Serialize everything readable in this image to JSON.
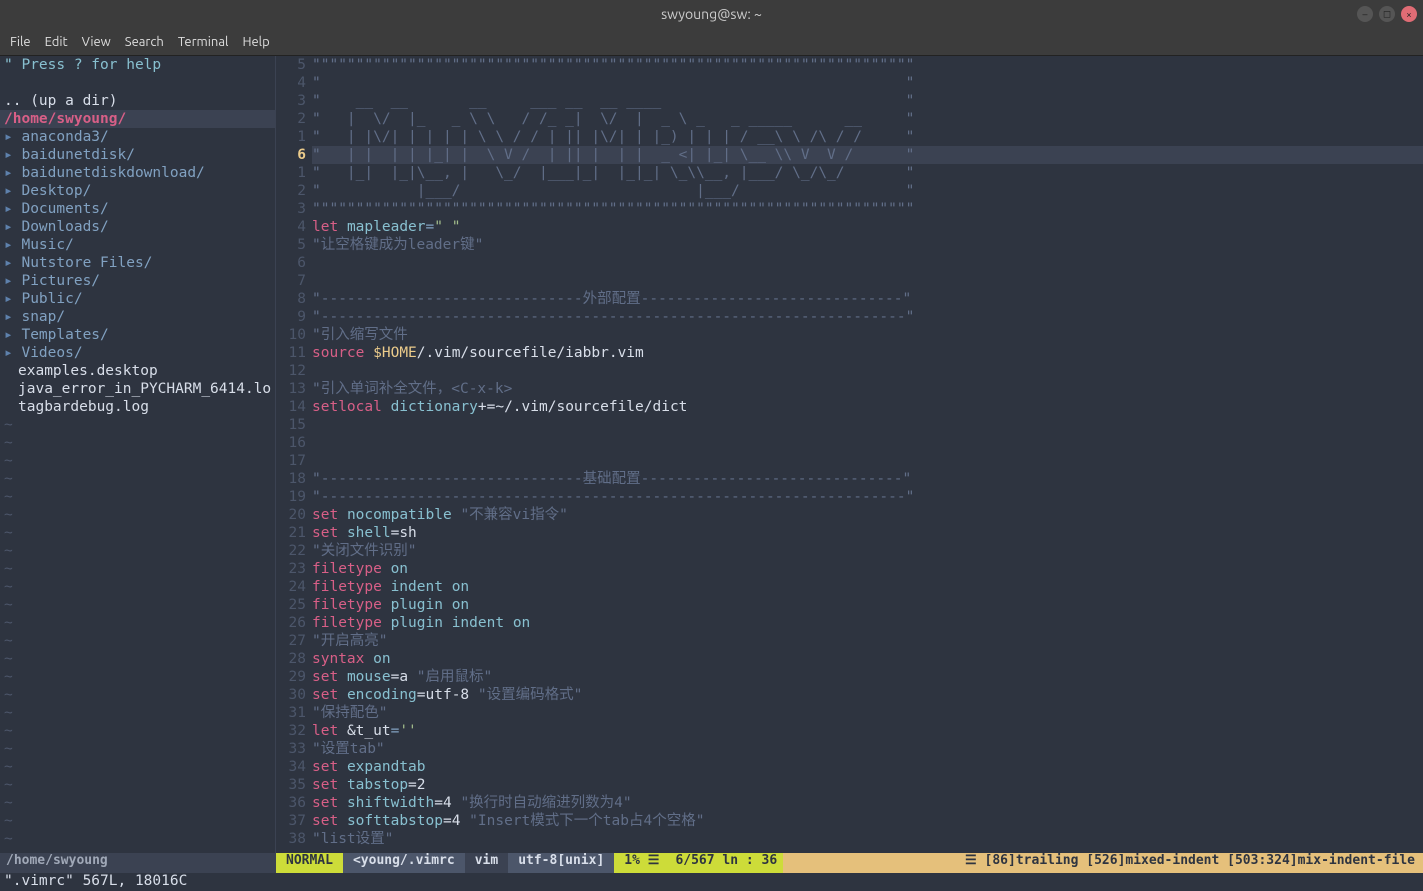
{
  "title": "swyoung@sw: ~",
  "menu": [
    "File",
    "Edit",
    "View",
    "Search",
    "Terminal",
    "Help"
  ],
  "sidebar": {
    "help": "\" Press ? for help",
    "updir": ".. (up a dir)",
    "cwd": "/home/swyoung/",
    "dirs": [
      "anaconda3/",
      "baidunetdisk/",
      "baidunetdiskdownload/",
      "Desktop/",
      "Documents/",
      "Downloads/",
      "Music/",
      "Nutstore Files/",
      "Pictures/",
      "Public/",
      "snap/",
      "Templates/",
      "Videos/"
    ],
    "files": [
      "examples.desktop",
      "java_error_in_PYCHARM_6414.lo",
      "tagbardebug.log"
    ]
  },
  "gutter": [
    "5",
    "4",
    "3",
    "2",
    "1",
    "6",
    "1",
    "2",
    "3",
    "4",
    "5",
    "6",
    "7",
    "8",
    "9",
    "10",
    "11",
    "12",
    "13",
    "14",
    "15",
    "16",
    "17",
    "18",
    "19",
    "20",
    "21",
    "22",
    "23",
    "24",
    "25",
    "26",
    "27",
    "28",
    "29",
    "30",
    "31",
    "32",
    "33",
    "34",
    "35",
    "36",
    "37",
    "38"
  ],
  "code": {
    "l0": "\"\"\"\"\"\"\"\"\"\"\"\"\"\"\"\"\"\"\"\"\"\"\"\"\"\"\"\"\"\"\"\"\"\"\"\"\"\"\"\"\"\"\"\"\"\"\"\"\"\"\"\"\"\"\"\"\"\"\"\"\"\"\"\"\"\"\"\"\"",
    "l1": "\"                                                                   \"",
    "l2": "\"    __  __       __     ___ __  __ ____                            \"",
    "l3": "\"   |  \\/  |_   _ \\ \\   / /_ _|  \\/  |  _ \\ _   _ _____      __     \"",
    "l4": "\"   | |\\/| | | | | \\ \\ / / | || |\\/| | |_) | | | / __\\ \\ /\\ / /     \"",
    "l5": "\"   | |  | | |_| |  \\ V /  | || |  | |  _ <| |_| \\__ \\\\ V  V /      \"",
    "l6": "\"   |_|  |_|\\__, |   \\_/  |___|_|  |_|_| \\_\\\\__, |___/ \\_/\\_/       \"",
    "l7": "\"           |___/                           |___/                   \"",
    "l8": "\"\"\"\"\"\"\"\"\"\"\"\"\"\"\"\"\"\"\"\"\"\"\"\"\"\"\"\"\"\"\"\"\"\"\"\"\"\"\"\"\"\"\"\"\"\"\"\"\"\"\"\"\"\"\"\"\"\"\"\"\"\"\"\"\"\"\"\"\"",
    "l9a": "let",
    "l9b": "mapleader",
    "l9c": "=",
    "l9d": "\" \"",
    "l10": "\"让空格键成为leader键\"",
    "l13": "\"------------------------------外部配置------------------------------\"",
    "l14": "\"-------------------------------------------------------------------\"",
    "l15": "\"引入缩写文件",
    "l16a": "source",
    "l16b": "$HOME",
    "l16c": "/.vim/sourcefile/iabbr.vim",
    "l18": "\"引入单词补全文件，<C-x-k>",
    "l19a": "setlocal",
    "l19b": "dictionary",
    "l19c": "+=~/.vim/sourcefile/dict",
    "l24": "\"------------------------------基础配置------------------------------\"",
    "l25": "\"-------------------------------------------------------------------\"",
    "l26a": "set",
    "l26b": "nocompatible",
    "l26c": "\"不兼容vi指令\"",
    "l27a": "set",
    "l27b": "shell",
    "l27c": "=sh",
    "l28": "\"关闭文件识别\"",
    "l29a": "filetype",
    "l29b": "on",
    "l30a": "filetype",
    "l30b": "indent",
    "l30c": "on",
    "l31a": "filetype",
    "l31b": "plugin",
    "l31c": "on",
    "l32a": "filetype",
    "l32b": "plugin",
    "l32c": "indent",
    "l32d": "on",
    "l33": "\"开启高亮\"",
    "l34a": "syntax",
    "l34b": "on",
    "l35a": "set",
    "l35b": "mouse",
    "l35c": "=a",
    "l35d": "\"启用鼠标\"",
    "l36a": "set",
    "l36b": "encoding",
    "l36c": "=utf-8",
    "l36d": "\"设置编码格式\"",
    "l37": "\"保持配色\"",
    "l38a": "let",
    "l38b": "&t_ut",
    "l38c": "=",
    "l38d": "''",
    "l39": "\"设置tab\"",
    "l40a": "set",
    "l40b": "expandtab",
    "l41a": "set",
    "l41b": "tabstop",
    "l41c": "=2",
    "l42a": "set",
    "l42b": "shiftwidth",
    "l42c": "=4",
    "l42d": "\"换行时自动缩进列数为4\"",
    "l43a": "set",
    "l43b": "softtabstop",
    "l43c": "=4",
    "l43d": "\"Insert模式下一个tab占4个空格\"",
    "l44": "\"list设置\""
  },
  "status": {
    "tab": "/home/swyoung",
    "mode": "NORMAL",
    "file": "<young/.vimrc",
    "ft": "vim",
    "enc": "utf-8[unix]",
    "pct": "1% ☰",
    "pos": "6/567 ln : 36",
    "warn": "☰ [86]trailing [526]mixed-indent [503:324]mix-indent-file"
  },
  "cmdline": "\".vimrc\" 567L, 18016C"
}
